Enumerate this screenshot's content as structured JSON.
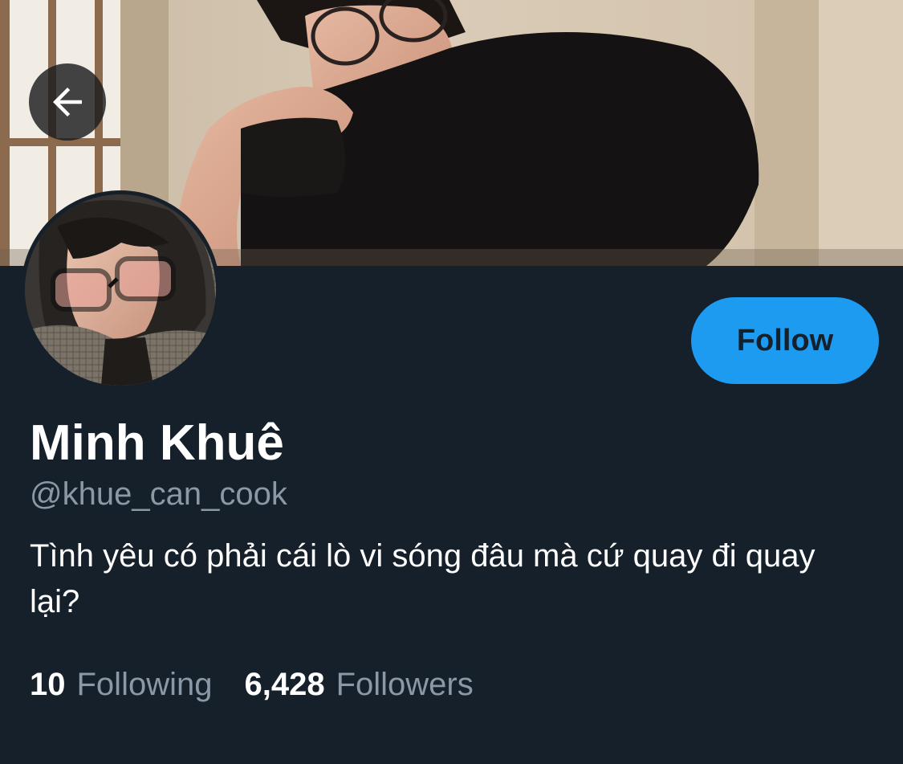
{
  "profile": {
    "display_name": "Minh Khuê",
    "handle": "@khue_can_cook",
    "bio": "Tình yêu có phải cái lò vi sóng đâu mà cứ quay đi quay lại?",
    "banner_image": "photo",
    "avatar_image": "photo"
  },
  "actions": {
    "follow_label": "Follow",
    "back_icon": "arrow-left-icon"
  },
  "stats": {
    "following_count": "10",
    "following_label": "Following",
    "followers_count": "6,428",
    "followers_label": "Followers"
  },
  "colors": {
    "background": "#15202b",
    "accent": "#1d9bf0",
    "text_primary": "#ffffff",
    "text_secondary": "#8b98a5"
  }
}
